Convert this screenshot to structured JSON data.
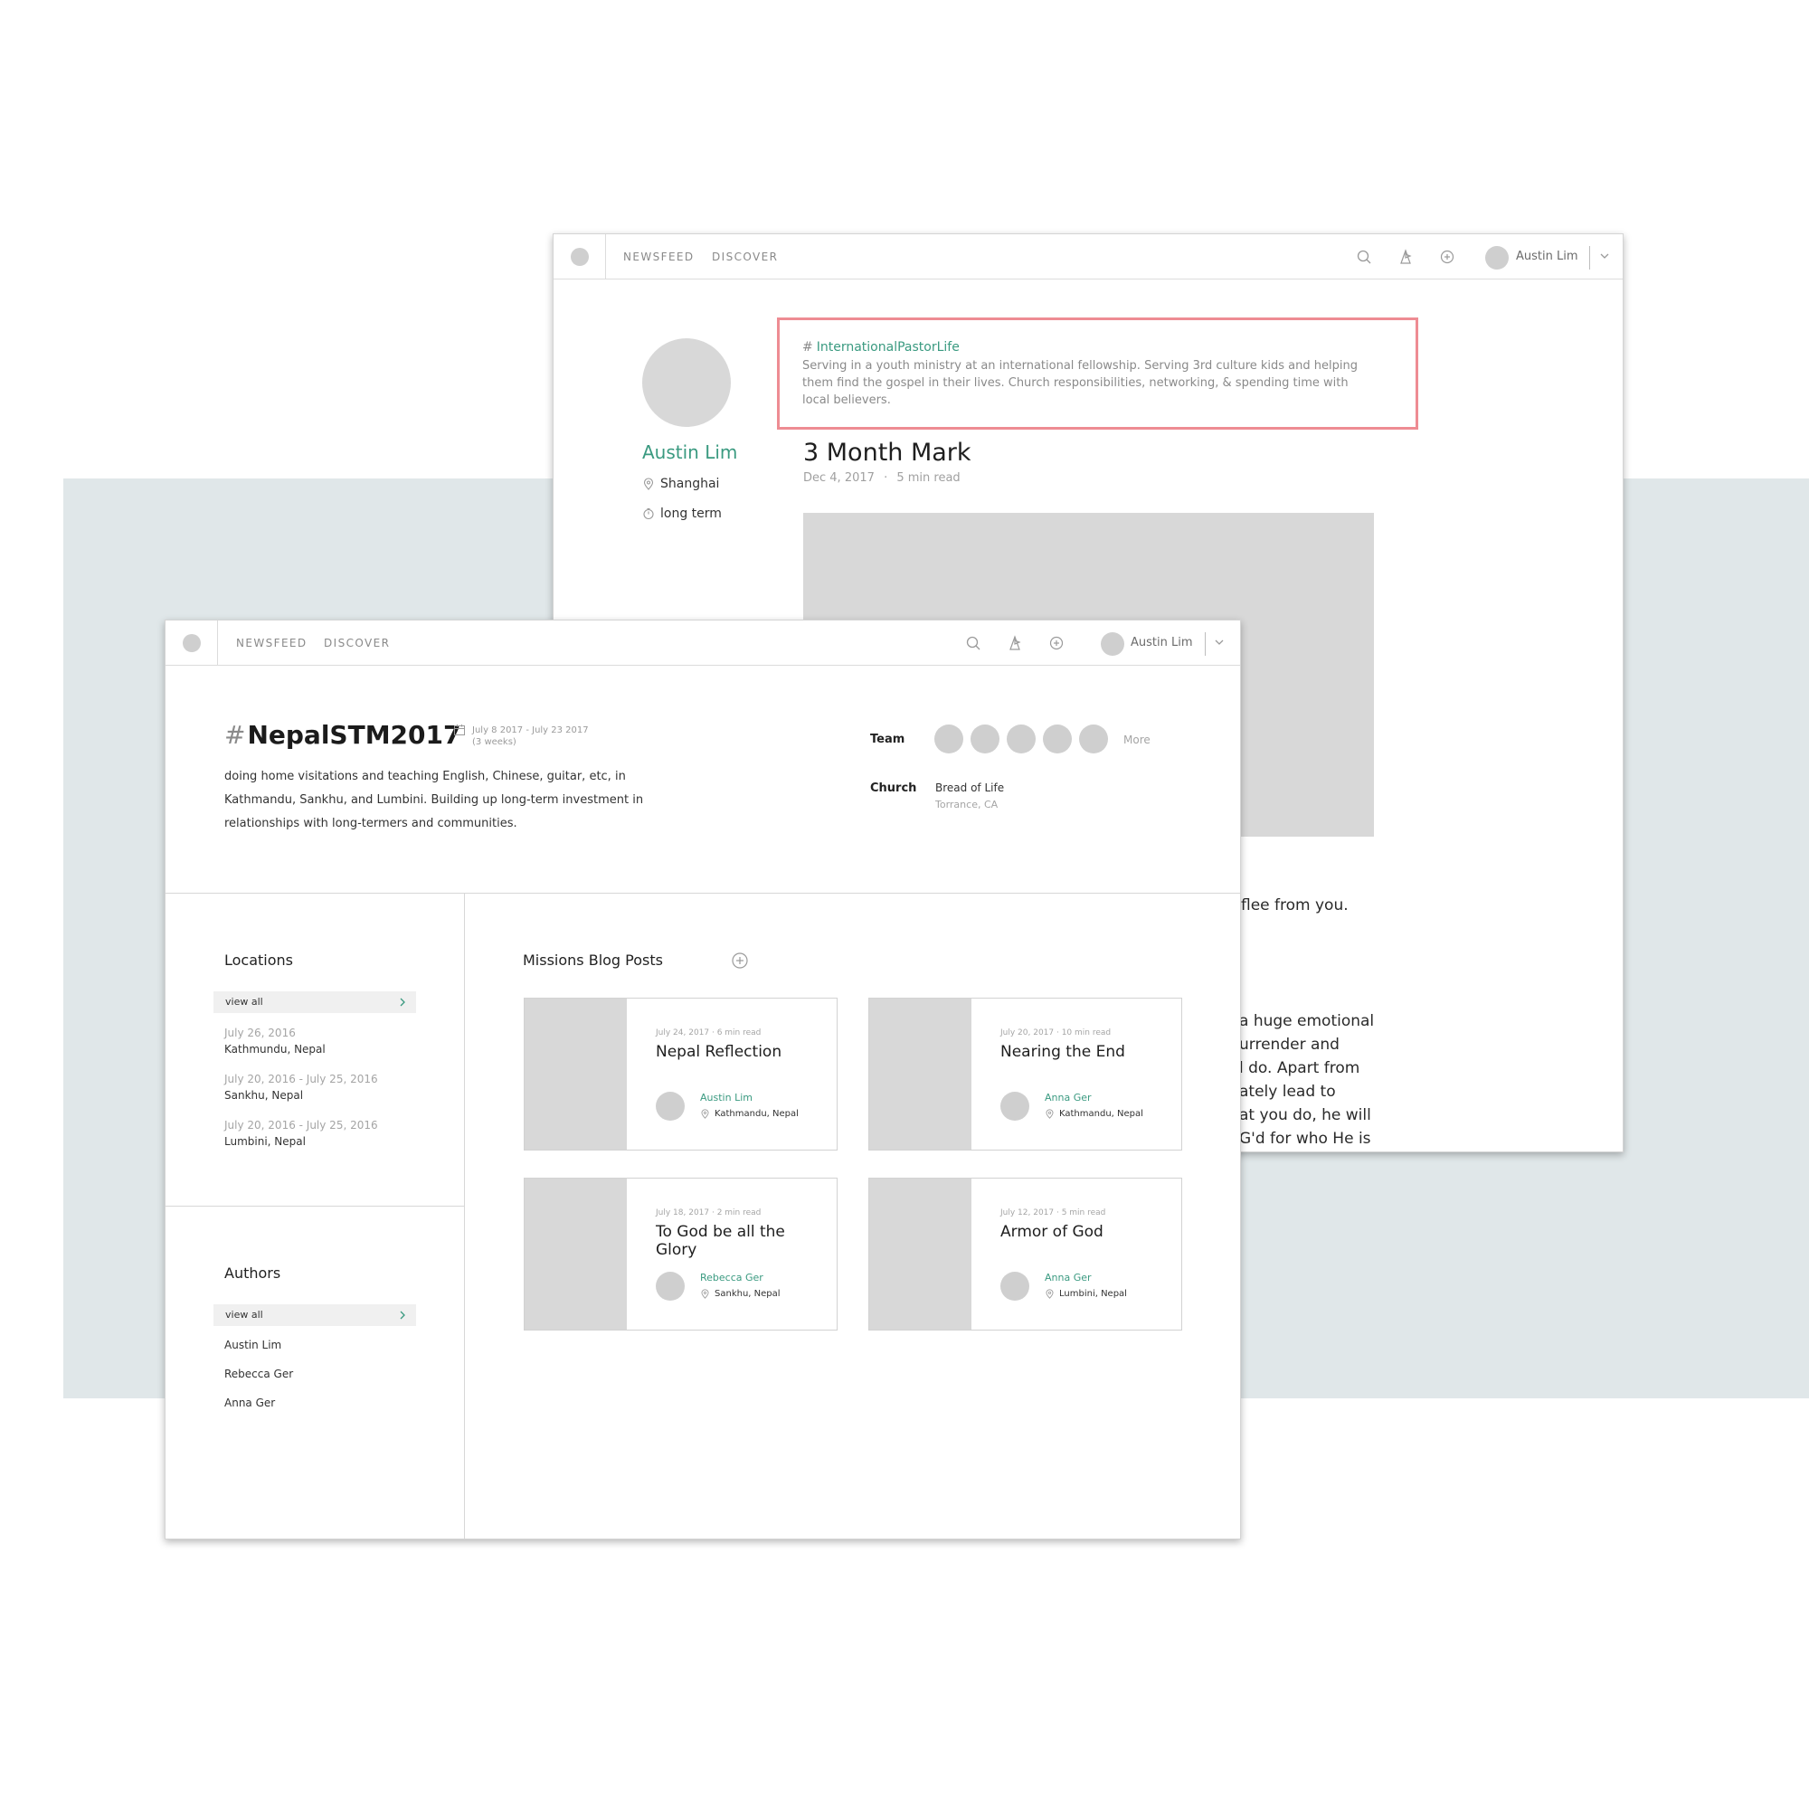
{
  "nav": {
    "newsfeed": "NEWSFEED",
    "discover": "DISCOVER",
    "username": "Austin Lim"
  },
  "profile": {
    "name": "Austin Lim",
    "location": "Shanghai",
    "term": "long term",
    "hashtag_symbol": "#",
    "hashtag": "InternationalPastorLife",
    "bio": "Serving in a youth ministry at an international fellowship. Serving 3rd culture kids and helping them find the gospel in their lives. Church responsibilities, networking, & spending time with local believers."
  },
  "post": {
    "title": "3 Month Mark",
    "date": "Dec 4, 2017",
    "separator": "·",
    "read_time": "5 min read",
    "body_fragments": [
      "flee from you.",
      "a huge emotional",
      "urrender and",
      "l do. Apart from",
      "ately lead to",
      "at you do, he will",
      "G'd for who He is"
    ]
  },
  "trip": {
    "hash_symbol": "#",
    "hashtag": "NepalSTM2017",
    "date_range": "July 8 2017 - July 23 2017",
    "duration": "(3 weeks)",
    "description": "doing home visitations and teaching English, Chinese, guitar, etc, in Kathmandu, Sankhu, and Lumbini.  Building up long-term investment in relationships with long-termers and communities.",
    "team_label": "Team",
    "team_more": "More",
    "church_label": "Church",
    "church_name": "Bread of Life",
    "church_location": "Torrance, CA"
  },
  "locations": {
    "title": "Locations",
    "view_all": "view all",
    "items": [
      {
        "date": "July 26, 2016",
        "name": "Kathmundu, Nepal"
      },
      {
        "date": "July 20, 2016 - July 25, 2016",
        "name": "Sankhu, Nepal"
      },
      {
        "date": "July 20, 2016 - July 25, 2016",
        "name": "Lumbini, Nepal"
      }
    ]
  },
  "authors": {
    "title": "Authors",
    "view_all": "view all",
    "items": [
      "Austin Lim",
      "Rebecca Ger",
      "Anna Ger"
    ]
  },
  "blog": {
    "title": "Missions Blog Posts",
    "posts": [
      {
        "meta": "July 24, 2017  ·  6 min read",
        "title": "Nepal Reflection",
        "author": "Austin Lim",
        "location": "Kathmandu, Nepal"
      },
      {
        "meta": "July 20, 2017  ·  10 min read",
        "title": "Nearing the End",
        "author": "Anna Ger",
        "location": "Kathmandu, Nepal"
      },
      {
        "meta": "July 18, 2017  ·  2 min read",
        "title": "To God be all the Glory",
        "author": "Rebecca Ger",
        "location": "Sankhu, Nepal"
      },
      {
        "meta": "July 12, 2017  ·  5 min read",
        "title": "Armor of God",
        "author": "Anna Ger",
        "location": "Lumbini, Nepal"
      }
    ]
  },
  "colors": {
    "accent": "#3a9a80",
    "highlight": "#ee8c93",
    "placeholder": "#d8d8d8",
    "band": "#e0e7e9"
  }
}
